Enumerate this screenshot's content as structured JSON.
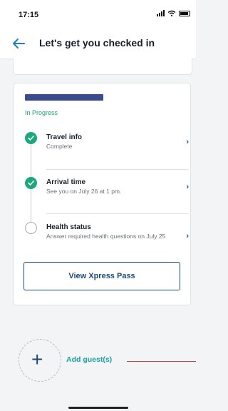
{
  "status_bar": {
    "time": "17:15"
  },
  "header": {
    "title": "Let's get you checked in"
  },
  "card": {
    "status": "In Progress",
    "steps": [
      {
        "label": "Travel info",
        "sub": "Complete",
        "state": "done"
      },
      {
        "label": "Arrival time",
        "sub": "See you on July 26 at 1 pm.",
        "state": "done"
      },
      {
        "label": "Health status",
        "sub": "Answer required health questions on July 25",
        "state": "todo"
      }
    ],
    "xpress_button": "View Xpress Pass"
  },
  "add_guest": {
    "label": "Add guest(s)"
  },
  "colors": {
    "accent": "#1aa87d",
    "primary": "#1b4a7a",
    "link": "#1a9fa0",
    "annotation": "#d23a3a"
  },
  "icons": {
    "back": "arrow-left-icon",
    "check": "check-icon",
    "chevron": "chevron-right-icon",
    "add": "plus-icon"
  }
}
